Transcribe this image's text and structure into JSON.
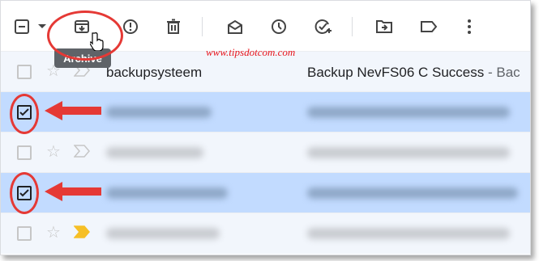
{
  "toolbar": {
    "tooltip": "Archive",
    "icons": [
      "select-checkbox-icon",
      "dropdown-caret-icon",
      "archive-icon",
      "report-spam-icon",
      "delete-icon",
      "mark-read-icon",
      "snooze-icon",
      "add-task-icon",
      "move-to-icon",
      "label-icon",
      "more-vert-icon"
    ]
  },
  "watermark": "www.tipsdotcom.com",
  "rows": [
    {
      "sender": "backupsysteem",
      "subject": "Backup NevFS06 C Success",
      "snippet": " - Bac",
      "checked": false,
      "important": false
    },
    {
      "sender": "",
      "subject": "",
      "snippet": "",
      "checked": true,
      "important": false
    },
    {
      "sender": "",
      "subject": "",
      "snippet": "",
      "checked": false,
      "important": false
    },
    {
      "sender": "",
      "subject": "",
      "snippet": "",
      "checked": true,
      "important": false
    },
    {
      "sender": "",
      "subject": "",
      "snippet": "",
      "checked": false,
      "important": true
    }
  ],
  "colors": {
    "selected": "#c2dbff",
    "annotation": "#e53935",
    "important": "#f6bf26"
  }
}
